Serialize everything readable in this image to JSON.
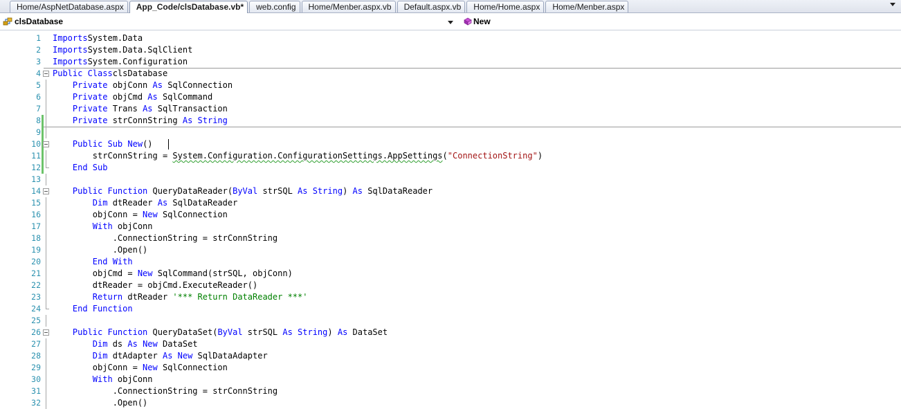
{
  "tabs": [
    {
      "label": "Home/AspNetDatabase.aspx",
      "active": false
    },
    {
      "label": "App_Code/clsDatabase.vb*",
      "active": true
    },
    {
      "label": "web.config",
      "active": false
    },
    {
      "label": "Home/Menber.aspx.vb",
      "active": false
    },
    {
      "label": "Default.aspx.vb",
      "active": false
    },
    {
      "label": "Home/Home.aspx",
      "active": false
    },
    {
      "label": "Home/Menber.aspx",
      "active": false
    }
  ],
  "navbar": {
    "class_combo": "clsDatabase",
    "member_combo": "New"
  },
  "code_lines": [
    {
      "n": "1",
      "tokens": [
        [
          "kw",
          "Imports"
        ],
        [
          "",
          "System.Data"
        ]
      ]
    },
    {
      "n": "2",
      "tokens": [
        [
          "kw",
          "Imports"
        ],
        [
          "",
          "System.Data.SqlClient"
        ]
      ]
    },
    {
      "n": "3",
      "tokens": [
        [
          "kw",
          "Imports"
        ],
        [
          "",
          "System.Configuration"
        ]
      ]
    },
    {
      "n": "4",
      "tokens": [
        [
          "kw",
          "Public Class"
        ],
        [
          "",
          "clsDatabase"
        ]
      ]
    },
    {
      "n": "5",
      "tokens": [
        [
          "",
          "    "
        ],
        [
          "kw",
          "Private"
        ],
        [
          "",
          " objConn "
        ],
        [
          "kw",
          "As"
        ],
        [
          "",
          " SqlConnection"
        ]
      ]
    },
    {
      "n": "6",
      "tokens": [
        [
          "",
          "    "
        ],
        [
          "kw",
          "Private"
        ],
        [
          "",
          " objCmd "
        ],
        [
          "kw",
          "As"
        ],
        [
          "",
          " SqlCommand"
        ]
      ]
    },
    {
      "n": "7",
      "tokens": [
        [
          "",
          "    "
        ],
        [
          "kw",
          "Private"
        ],
        [
          "",
          " Trans "
        ],
        [
          "kw",
          "As"
        ],
        [
          "",
          " SqlTransaction"
        ]
      ]
    },
    {
      "n": "8",
      "tokens": [
        [
          "",
          "    "
        ],
        [
          "kw",
          "Private"
        ],
        [
          "",
          " strConnString "
        ],
        [
          "kw",
          "As String"
        ]
      ]
    },
    {
      "n": "9",
      "tokens": []
    },
    {
      "n": "10",
      "tokens": [
        [
          "",
          "    "
        ],
        [
          "kw",
          "Public Sub New"
        ],
        [
          "",
          "() "
        ]
      ]
    },
    {
      "n": "11",
      "tokens": [
        [
          "",
          "        strConnString = "
        ],
        [
          "sq",
          "System.Configuration.ConfigurationSettings.AppSettings"
        ],
        [
          "",
          "("
        ],
        [
          "str",
          "\"ConnectionString\""
        ],
        [
          "",
          ")"
        ]
      ]
    },
    {
      "n": "12",
      "tokens": [
        [
          "",
          "    "
        ],
        [
          "kw",
          "End Sub"
        ]
      ]
    },
    {
      "n": "13",
      "tokens": []
    },
    {
      "n": "14",
      "tokens": [
        [
          "",
          "    "
        ],
        [
          "kw",
          "Public Function"
        ],
        [
          "",
          " QueryDataReader("
        ],
        [
          "kw",
          "ByVal"
        ],
        [
          "",
          " strSQL "
        ],
        [
          "kw",
          "As String"
        ],
        [
          "",
          ") "
        ],
        [
          "kw",
          "As"
        ],
        [
          "",
          " SqlDataReader"
        ]
      ]
    },
    {
      "n": "15",
      "tokens": [
        [
          "",
          "        "
        ],
        [
          "kw",
          "Dim"
        ],
        [
          "",
          " dtReader "
        ],
        [
          "kw",
          "As"
        ],
        [
          "",
          " SqlDataReader"
        ]
      ]
    },
    {
      "n": "16",
      "tokens": [
        [
          "",
          "        objConn = "
        ],
        [
          "kw",
          "New"
        ],
        [
          "",
          " SqlConnection"
        ]
      ]
    },
    {
      "n": "17",
      "tokens": [
        [
          "",
          "        "
        ],
        [
          "kw",
          "With"
        ],
        [
          "",
          " objConn"
        ]
      ]
    },
    {
      "n": "18",
      "tokens": [
        [
          "",
          "            .ConnectionString = strConnString"
        ]
      ]
    },
    {
      "n": "19",
      "tokens": [
        [
          "",
          "            .Open()"
        ]
      ]
    },
    {
      "n": "20",
      "tokens": [
        [
          "",
          "        "
        ],
        [
          "kw",
          "End With"
        ]
      ]
    },
    {
      "n": "21",
      "tokens": [
        [
          "",
          "        objCmd = "
        ],
        [
          "kw",
          "New"
        ],
        [
          "",
          " SqlCommand(strSQL, objConn)"
        ]
      ]
    },
    {
      "n": "22",
      "tokens": [
        [
          "",
          "        dtReader = objCmd.ExecuteReader()"
        ]
      ]
    },
    {
      "n": "23",
      "tokens": [
        [
          "",
          "        "
        ],
        [
          "kw",
          "Return"
        ],
        [
          "",
          " dtReader "
        ],
        [
          "cmt",
          "'*** Return DataReader ***'"
        ]
      ]
    },
    {
      "n": "24",
      "tokens": [
        [
          "",
          "    "
        ],
        [
          "kw",
          "End Function"
        ]
      ]
    },
    {
      "n": "25",
      "tokens": []
    },
    {
      "n": "26",
      "tokens": [
        [
          "",
          "    "
        ],
        [
          "kw",
          "Public Function"
        ],
        [
          "",
          " QueryDataSet("
        ],
        [
          "kw",
          "ByVal"
        ],
        [
          "",
          " strSQL "
        ],
        [
          "kw",
          "As String"
        ],
        [
          "",
          ") "
        ],
        [
          "kw",
          "As"
        ],
        [
          "",
          " DataSet"
        ]
      ]
    },
    {
      "n": "27",
      "tokens": [
        [
          "",
          "        "
        ],
        [
          "kw",
          "Dim"
        ],
        [
          "",
          " ds "
        ],
        [
          "kw",
          "As New"
        ],
        [
          "",
          " DataSet"
        ]
      ]
    },
    {
      "n": "28",
      "tokens": [
        [
          "",
          "        "
        ],
        [
          "kw",
          "Dim"
        ],
        [
          "",
          " dtAdapter "
        ],
        [
          "kw",
          "As New"
        ],
        [
          "",
          " SqlDataAdapter"
        ]
      ]
    },
    {
      "n": "29",
      "tokens": [
        [
          "",
          "        objConn = "
        ],
        [
          "kw",
          "New"
        ],
        [
          "",
          " SqlConnection"
        ]
      ]
    },
    {
      "n": "30",
      "tokens": [
        [
          "",
          "        "
        ],
        [
          "kw",
          "With"
        ],
        [
          "",
          " objConn"
        ]
      ]
    },
    {
      "n": "31",
      "tokens": [
        [
          "",
          "            .ConnectionString = strConnString"
        ]
      ]
    },
    {
      "n": "32",
      "tokens": [
        [
          "",
          "            .Open()"
        ]
      ]
    }
  ],
  "colors": {
    "keyword": "#0000ff",
    "string": "#a31515",
    "comment": "#008000",
    "line_number": "#2b91af",
    "change_marker": "#6cc36a"
  }
}
